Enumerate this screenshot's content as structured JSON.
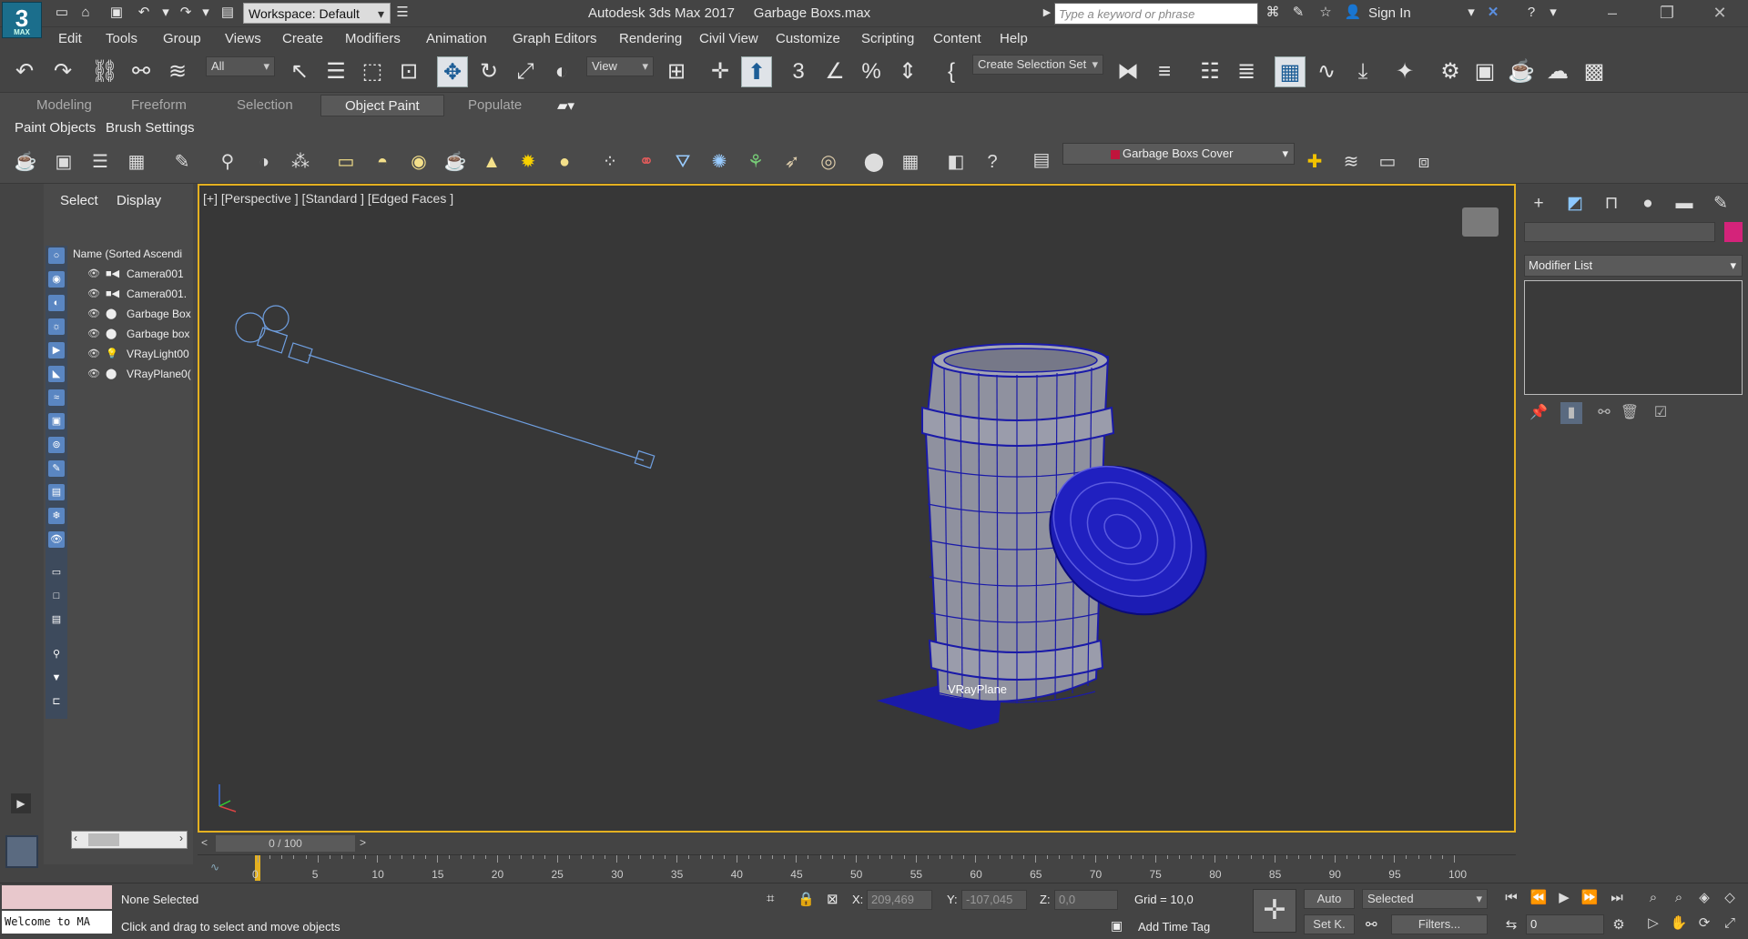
{
  "app": {
    "logo_text": "3",
    "logo_sub": "MAX",
    "title": "Autodesk 3ds Max 2017     Garbage Boxs.max",
    "workspace": "Workspace: Default",
    "search_placeholder": "Type a keyword or phrase",
    "sign_in": "Sign In"
  },
  "menu": [
    "Edit",
    "Tools",
    "Group",
    "Views",
    "Create",
    "Modifiers",
    "Animation",
    "Graph Editors",
    "Rendering",
    "Civil View",
    "Customize",
    "Scripting",
    "Content",
    "Help"
  ],
  "toolbar": {
    "filter": "All",
    "ref_coord": "View",
    "selection_set": "Create Selection Set"
  },
  "ribbon": {
    "tabs": [
      "Modeling",
      "Freeform",
      "Selection",
      "Object Paint",
      "Populate"
    ],
    "active_tab": "Object Paint",
    "subtabs": [
      "Paint Objects",
      "Brush Settings"
    ],
    "object_dropdown": "Garbage Boxs Cover",
    "object_color": "#c0143c"
  },
  "scene_explorer": {
    "tabs": [
      "Select",
      "Display"
    ],
    "header": "Name (Sorted Ascendi",
    "items": [
      {
        "name": "Camera001",
        "type": "camera"
      },
      {
        "name": "Camera001.",
        "type": "camera"
      },
      {
        "name": "Garbage Box",
        "type": "geometry"
      },
      {
        "name": "Garbage box",
        "type": "geometry"
      },
      {
        "name": "VRayLight00",
        "type": "light"
      },
      {
        "name": "VRayPlane0(",
        "type": "geometry"
      }
    ]
  },
  "viewport": {
    "label": "[+] [Perspective ] [Standard ] [Edged Faces ]",
    "object_label": "VRayPlane",
    "wire_color": "#1a1aa8"
  },
  "timeline": {
    "frame": "0 / 100",
    "ticks": [
      "0",
      "5",
      "10",
      "15",
      "20",
      "25",
      "30",
      "35",
      "40",
      "45",
      "50",
      "55",
      "60",
      "65",
      "70",
      "75",
      "80",
      "85",
      "90",
      "95",
      "100"
    ]
  },
  "status": {
    "maxscript": "Welcome to MA",
    "selection": "None Selected",
    "prompt": "Click and drag to select and move objects",
    "x_label": "X:",
    "x": "209,469",
    "y_label": "Y:",
    "y": "-107,045",
    "z_label": "Z:",
    "z": "0,0",
    "grid": "Grid = 10,0",
    "add_time_tag": "Add Time Tag",
    "auto": "Auto",
    "set_key": "Set K.",
    "key_filter": "Selected",
    "filters": "Filters...",
    "current_frame": "0"
  },
  "command_panel": {
    "object_color": "#d4237a",
    "modifier_list": "Modifier List"
  }
}
